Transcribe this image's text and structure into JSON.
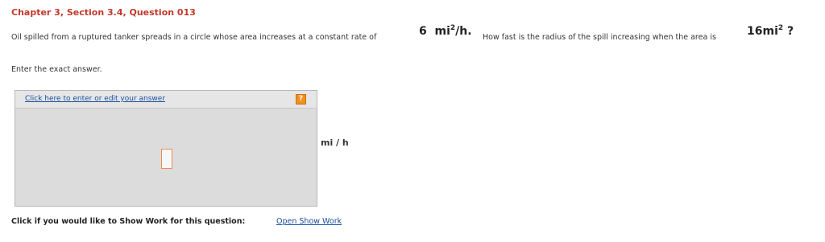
{
  "header": {
    "chapter_title": "Chapter 3, Section 3.4, Question 013"
  },
  "question": {
    "text_part1": "Oil spilled from a ruptured tanker spreads in a circle whose area increases at a constant rate of",
    "rate_value": "6",
    "rate_unit_base": "mi",
    "rate_unit_exp": "2",
    "rate_unit_tail": "/h.",
    "text_part2": "How fast is the radius of the spill increasing when the area is",
    "area_value": "16mi",
    "area_exp": "2",
    "area_tail": "?"
  },
  "instruction": "Enter the exact answer.",
  "answer_box": {
    "link_label": "Click here to enter or edit your answer",
    "help_icon_label": "?",
    "help_icon_color": "#f0901e",
    "placeholder_border_color": "#f08a50",
    "unit": "mi / h"
  },
  "show_work": {
    "prompt": "Click if you would like to Show Work for this question:",
    "link_label": "Open Show Work"
  },
  "colors": {
    "chapter_title": "#c0392b",
    "link": "#1a4fa0",
    "answer_box_bg": "#dcdcdc"
  }
}
